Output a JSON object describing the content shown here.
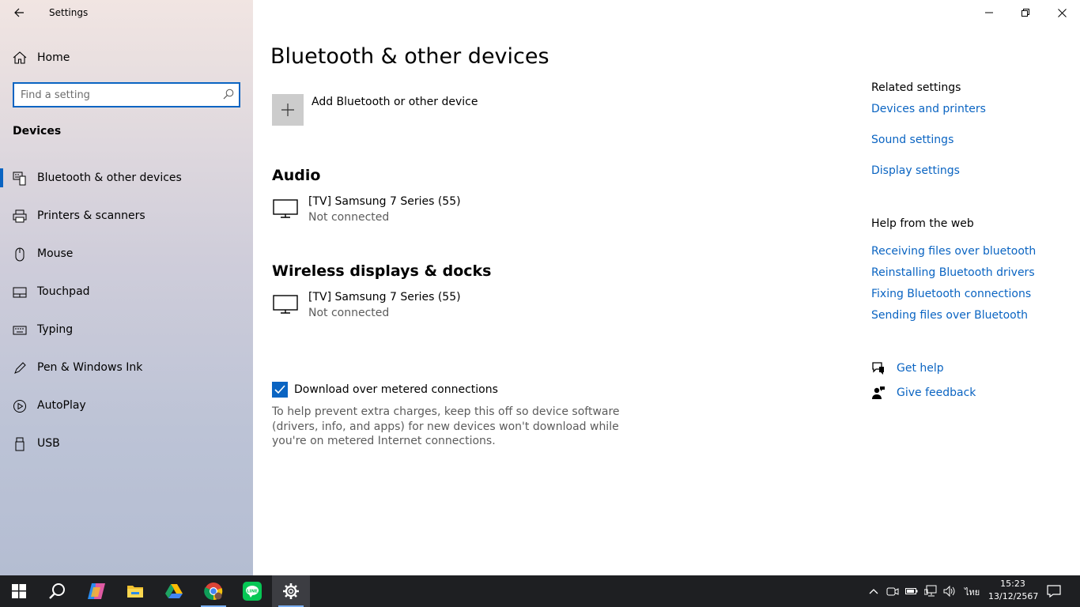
{
  "window": {
    "title": "Settings",
    "caption": {
      "minimize": "minimize-icon",
      "restore": "restore-icon",
      "close": "close-icon"
    }
  },
  "sidebar": {
    "home_label": "Home",
    "search_placeholder": "Find a setting",
    "section": "Devices",
    "items": [
      {
        "label": "Bluetooth & other devices",
        "icon": "bluetooth-devices-icon",
        "active": true
      },
      {
        "label": "Printers & scanners",
        "icon": "printer-icon"
      },
      {
        "label": "Mouse",
        "icon": "mouse-icon"
      },
      {
        "label": "Touchpad",
        "icon": "touchpad-icon"
      },
      {
        "label": "Typing",
        "icon": "keyboard-icon"
      },
      {
        "label": "Pen & Windows Ink",
        "icon": "pen-icon"
      },
      {
        "label": "AutoPlay",
        "icon": "autoplay-icon"
      },
      {
        "label": "USB",
        "icon": "usb-icon"
      }
    ]
  },
  "main": {
    "title": "Bluetooth & other devices",
    "add_device_label": "Add Bluetooth or other device",
    "audio": {
      "heading": "Audio",
      "device_name": "[TV] Samsung 7 Series (55)",
      "device_status": "Not connected"
    },
    "wireless": {
      "heading": "Wireless displays & docks",
      "device_name": "[TV] Samsung 7 Series (55)",
      "device_status": "Not connected"
    },
    "metered": {
      "label": "Download over metered connections",
      "checked": true,
      "description": "To help prevent extra charges, keep this off so device software (drivers, info, and apps) for new devices won't download while you're on metered Internet connections."
    }
  },
  "related": {
    "heading": "Related settings",
    "links": [
      "Devices and printers",
      "Sound settings",
      "Display settings"
    ]
  },
  "help": {
    "heading": "Help from the web",
    "links": [
      "Receiving files over bluetooth",
      "Reinstalling Bluetooth drivers",
      "Fixing Bluetooth connections",
      "Sending files over Bluetooth"
    ],
    "get_help": "Get help",
    "give_feedback": "Give feedback"
  },
  "taskbar": {
    "apps": [
      "start-icon",
      "search-icon",
      "copilot-icon",
      "file-explorer-icon",
      "google-drive-icon",
      "chrome-icon",
      "line-icon",
      "settings-icon"
    ],
    "language": "ไทย",
    "time": "15:23",
    "date": "13/12/2567",
    "accent": "#0a64c2"
  }
}
